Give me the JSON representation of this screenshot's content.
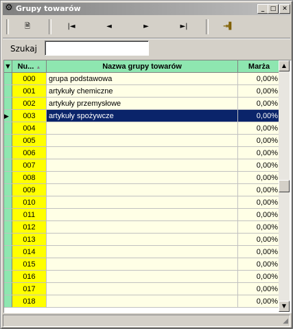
{
  "window": {
    "title": "Grupy towarów",
    "minimize": "_",
    "maximize": "□",
    "close": "✕"
  },
  "toolbar": {
    "buttons": [
      {
        "name": "refresh-button",
        "glyph": "🗎"
      },
      {
        "name": "first-record-button",
        "glyph": "|◄"
      },
      {
        "name": "previous-record-button",
        "glyph": "◄"
      },
      {
        "name": "next-record-button",
        "glyph": "►"
      },
      {
        "name": "last-record-button",
        "glyph": "►|"
      },
      {
        "name": "exit-button",
        "glyph": "⇥▌"
      }
    ]
  },
  "search": {
    "label": "Szukaj",
    "value": ""
  },
  "grid": {
    "columns": {
      "num": "Nu...",
      "name": "Nazwa grupy towarów",
      "marza": "Marża"
    },
    "sort_indicator": "▲",
    "rows": [
      {
        "num": "000",
        "name": "grupa podstawowa",
        "marza": "0,00%"
      },
      {
        "num": "001",
        "name": "artykuły chemiczne",
        "marza": "0,00%"
      },
      {
        "num": "002",
        "name": "artykuły przemysłowe",
        "marza": "0,00%"
      },
      {
        "num": "003",
        "name": "artykuły spożywcze",
        "marza": "0,00%",
        "selected": true
      },
      {
        "num": "004",
        "name": "",
        "marza": "0,00%"
      },
      {
        "num": "005",
        "name": "",
        "marza": "0,00%"
      },
      {
        "num": "006",
        "name": "",
        "marza": "0,00%"
      },
      {
        "num": "007",
        "name": "",
        "marza": "0,00%"
      },
      {
        "num": "008",
        "name": "",
        "marza": "0,00%"
      },
      {
        "num": "009",
        "name": "",
        "marza": "0,00%"
      },
      {
        "num": "010",
        "name": "",
        "marza": "0,00%"
      },
      {
        "num": "011",
        "name": "",
        "marza": "0,00%"
      },
      {
        "num": "012",
        "name": "",
        "marza": "0,00%"
      },
      {
        "num": "013",
        "name": "",
        "marza": "0,00%"
      },
      {
        "num": "014",
        "name": "",
        "marza": "0,00%"
      },
      {
        "num": "015",
        "name": "",
        "marza": "0,00%"
      },
      {
        "num": "016",
        "name": "",
        "marza": "0,00%"
      },
      {
        "num": "017",
        "name": "",
        "marza": "0,00%"
      },
      {
        "num": "018",
        "name": "",
        "marza": "0,00%"
      }
    ]
  },
  "colors": {
    "header": "#8ee6b0",
    "number_cell": "#ffff00",
    "row_bg": "#ffffe6",
    "selected": "#0a246a"
  }
}
